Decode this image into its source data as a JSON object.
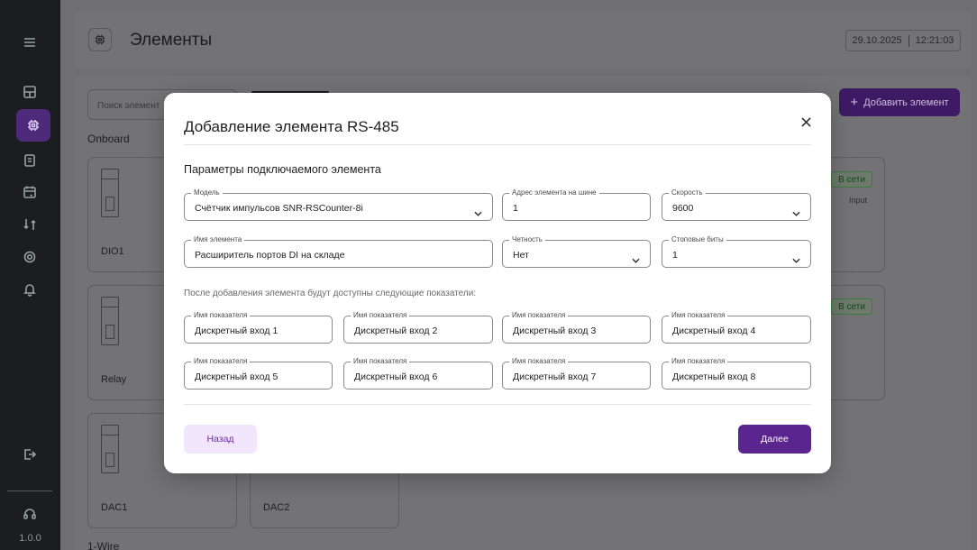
{
  "app": {
    "version": "1.0.0"
  },
  "header": {
    "title": "Элементы",
    "date": "29.10.2025",
    "time": "12:21:03"
  },
  "sidebar": {
    "items": [
      {
        "icon": "menu-icon"
      },
      {
        "icon": "dashboard-icon"
      },
      {
        "icon": "chip-icon",
        "active": true
      },
      {
        "icon": "document-icon"
      },
      {
        "icon": "calendar-icon"
      },
      {
        "icon": "transfer-icon"
      },
      {
        "icon": "settings-icon"
      },
      {
        "icon": "bell-icon"
      },
      {
        "icon": "logout-icon"
      },
      {
        "icon": "support-icon"
      }
    ]
  },
  "toolbar": {
    "search_placeholder": "Поиск элемент",
    "add_label": "Добавить элемент"
  },
  "sections": {
    "onboard": "Onboard",
    "onewire": "1-Wire"
  },
  "elements": [
    {
      "name": "DIO1"
    },
    {
      "name": "Relay"
    },
    {
      "name": "DAC1"
    },
    {
      "name": "DAC2"
    }
  ],
  "status": {
    "online": "В сети",
    "input": "Input"
  },
  "modal": {
    "title": "Добавление элемента RS-485",
    "subtitle": "Параметры подключаемого элемента",
    "fields": {
      "model": {
        "label": "Модель",
        "value": "Счётчик импульсов SNR-RSCounter-8i"
      },
      "address": {
        "label": "Адрес элемента на шине",
        "value": "1"
      },
      "speed": {
        "label": "Скорость",
        "value": "9600"
      },
      "name": {
        "label": "Имя элемента",
        "value": "Расширитель портов DI на складе"
      },
      "parity": {
        "label": "Четность",
        "value": "Нет"
      },
      "stopbits": {
        "label": "Стоповые биты",
        "value": "1"
      }
    },
    "hint": "После добавления элемента будут доступны следующие показатели:",
    "indicator_label": "Имя показателя",
    "indicators": [
      "Дискретный вход 1",
      "Дискретный вход 2",
      "Дискретный вход 3",
      "Дискретный вход 4",
      "Дискретный вход 5",
      "Дискретный вход 6",
      "Дискретный вход 7",
      "Дискретный вход 8"
    ],
    "back_label": "Назад",
    "next_label": "Далее"
  }
}
